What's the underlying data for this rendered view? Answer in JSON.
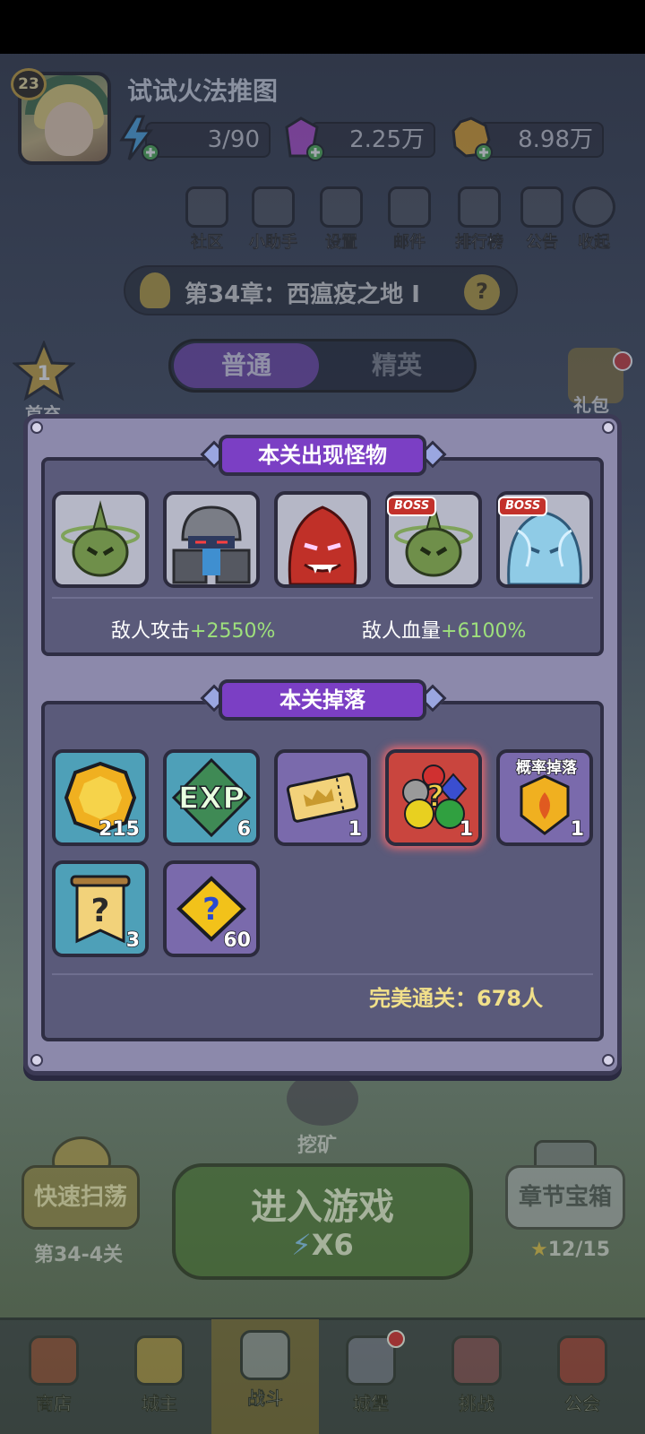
{
  "player": {
    "level": "23",
    "name": "试试火法推图",
    "energy": "3/90",
    "gems": "2.25万",
    "gold": "8.98万"
  },
  "menu": [
    {
      "name": "community",
      "label": "社区"
    },
    {
      "name": "assistant",
      "label": "小助手"
    },
    {
      "name": "settings",
      "label": "设置"
    },
    {
      "name": "mail",
      "label": "邮件"
    },
    {
      "name": "leaderboard",
      "label": "排行榜"
    },
    {
      "name": "announcement",
      "label": "公告"
    },
    {
      "name": "collapse",
      "label": "收起"
    }
  ],
  "chapter": {
    "title": "第34章：西瘟疫之地 I",
    "help": "?"
  },
  "mode_tabs": {
    "normal": "普通",
    "elite": "精英"
  },
  "side": {
    "first_clear_count": "1",
    "first_clear_label": "首充",
    "gift_label": "礼包"
  },
  "modal": {
    "monsters_title": "本关出现怪物",
    "monsters": [
      {
        "name": "green-spike-slime",
        "boss": false
      },
      {
        "name": "armored-knight",
        "boss": false
      },
      {
        "name": "red-demon",
        "boss": false
      },
      {
        "name": "green-spike-slime-boss",
        "boss": true
      },
      {
        "name": "ice-elemental-boss",
        "boss": true
      }
    ],
    "boss_label": "BOSS",
    "enemy_attack_label": "敌人攻击",
    "enemy_attack_value": "+2550%",
    "enemy_hp_label": "敌人血量",
    "enemy_hp_value": "+6100%",
    "drops_title": "本关掉落",
    "drops": [
      {
        "icon": "gold-coin-icon",
        "count": "215",
        "color": "teal"
      },
      {
        "icon": "exp-icon",
        "count": "6",
        "color": "teal",
        "text": "EXP"
      },
      {
        "icon": "crown-ticket-icon",
        "count": "1",
        "color": "purple"
      },
      {
        "icon": "mystery-gem-bundle-icon",
        "count": "1",
        "color": "red"
      },
      {
        "icon": "fire-rune-icon",
        "count": "1",
        "color": "purple",
        "tag": "概率掉落"
      },
      {
        "icon": "mystery-scroll-icon",
        "count": "3",
        "color": "teal"
      },
      {
        "icon": "mystery-puzzle-icon",
        "count": "60",
        "color": "purple"
      }
    ],
    "perfect_clear": "完美通关：678人"
  },
  "mining_label": "挖矿",
  "quick_sweep": {
    "label": "快速扫荡",
    "stage": "第34-4关"
  },
  "enter_game": {
    "label": "进入游戏",
    "cost": "X6"
  },
  "chapter_chest": {
    "label": "章节宝箱",
    "progress": "12/15"
  },
  "bottom_nav": [
    {
      "name": "shop",
      "label": "商店"
    },
    {
      "name": "lord",
      "label": "城主"
    },
    {
      "name": "battle",
      "label": "战斗"
    },
    {
      "name": "castle",
      "label": "城堡"
    },
    {
      "name": "challenge",
      "label": "挑战"
    },
    {
      "name": "guild",
      "label": "公会"
    }
  ],
  "colors": {
    "modal_bg": "#8c89ab",
    "section_header": "#7b3fc4",
    "stat_value": "#9ee07c",
    "perfect_clear": "#f1e08a"
  }
}
